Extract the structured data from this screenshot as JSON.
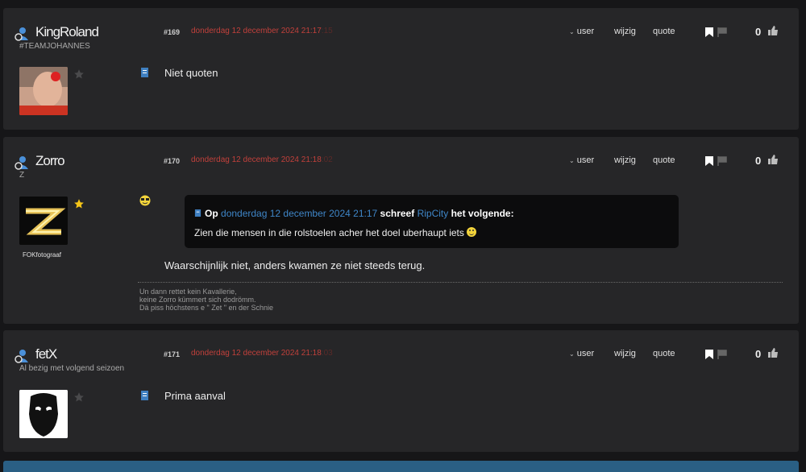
{
  "colors": {
    "page_bg": "#161618",
    "post_bg": "#262628",
    "date": "#c0403b",
    "link": "#3f86c8",
    "star_gold": "#f5c518",
    "bottom_bar": "#2a5f84"
  },
  "posts": [
    {
      "username": "KingRoland",
      "user_title": "#TEAMJOHANNES",
      "number": "#169",
      "date": "donderdag 12 december 2024  21:17",
      "seconds": ":15",
      "actions": {
        "user": "user",
        "edit": "wijzig",
        "quote": "quote"
      },
      "score": "0",
      "message": "Niet quoten",
      "star": "grey"
    },
    {
      "username": "Zorro",
      "user_title": "Z",
      "badge": "FOKfotograaf",
      "number": "#170",
      "date": "donderdag 12 december 2024  21:18",
      "seconds": ":02",
      "actions": {
        "user": "user",
        "edit": "wijzig",
        "quote": "quote"
      },
      "score": "0",
      "star": "gold",
      "quote": {
        "prefix": "Op",
        "date": "donderdag 12 december 2024 21:17",
        "wrote": "schreef",
        "author": "RipCity",
        "suffix": "het volgende:",
        "text": "Zien die mensen in die rolstoelen acher het doel uberhaupt iets"
      },
      "message": "Waarschijnlijk niet, anders kwamen ze niet steeds terug.",
      "signature": [
        "Un dann rettet kein Kavallerie,",
        "keine Zorro kümmert sich dodrömm.",
        "Dä piss höchstens e \" Zet \" en der Schnie"
      ]
    },
    {
      "username": "fetX",
      "user_title": "Al bezig met volgend seizoen",
      "number": "#171",
      "date": "donderdag 12 december 2024  21:18",
      "seconds": ":03",
      "actions": {
        "user": "user",
        "edit": "wijzig",
        "quote": "quote"
      },
      "score": "0",
      "message": "Prima aanval",
      "star": "grey"
    }
  ]
}
